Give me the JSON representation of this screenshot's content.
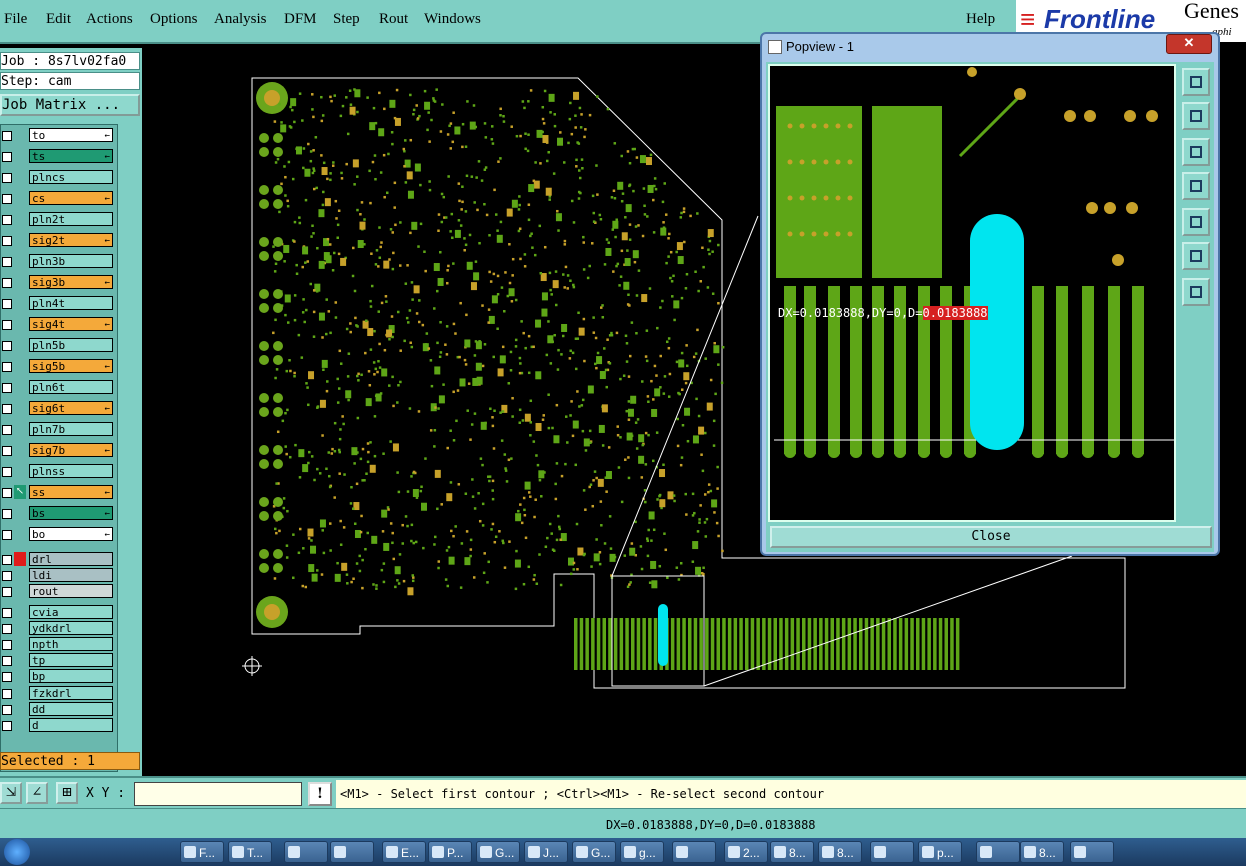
{
  "menu": {
    "items": [
      "File",
      "Edit",
      "Actions",
      "Options",
      "Analysis",
      "DFM",
      "Step",
      "Rout",
      "Windows"
    ],
    "help": "Help",
    "brand": "Frontline",
    "brand_suffix": "Genes",
    "brand_sub": "aphi"
  },
  "left": {
    "job": "Job : 8s7lv02fa0",
    "step": "Step: cam",
    "job_matrix": "Job Matrix ...",
    "selected": "Selected : 1",
    "layers": [
      {
        "name": "to",
        "color": "#ffffff",
        "flag": "←"
      },
      {
        "name": "ts",
        "color": "#1f9a73",
        "flag": "←"
      },
      {
        "name": "plncs",
        "color": "#8ed8cd",
        "flag": ""
      },
      {
        "name": "cs",
        "color": "#f4a93a",
        "flag": "←"
      },
      {
        "name": "pln2t",
        "color": "#8ed8cd",
        "flag": ""
      },
      {
        "name": "sig2t",
        "color": "#f4a93a",
        "flag": "←"
      },
      {
        "name": "pln3b",
        "color": "#8ed8cd",
        "flag": ""
      },
      {
        "name": "sig3b",
        "color": "#f4a93a",
        "flag": "←"
      },
      {
        "name": "pln4t",
        "color": "#8ed8cd",
        "flag": ""
      },
      {
        "name": "sig4t",
        "color": "#f4a93a",
        "flag": "←"
      },
      {
        "name": "pln5b",
        "color": "#8ed8cd",
        "flag": ""
      },
      {
        "name": "sig5b",
        "color": "#f4a93a",
        "flag": "←"
      },
      {
        "name": "pln6t",
        "color": "#8ed8cd",
        "flag": ""
      },
      {
        "name": "sig6t",
        "color": "#f4a93a",
        "flag": "←"
      },
      {
        "name": "pln7b",
        "color": "#8ed8cd",
        "flag": ""
      },
      {
        "name": "sig7b",
        "color": "#f4a93a",
        "flag": "←"
      },
      {
        "name": "plnss",
        "color": "#8ed8cd",
        "flag": ""
      },
      {
        "name": "ss",
        "color": "#f4a93a",
        "flag": "←"
      },
      {
        "name": "bs",
        "color": "#1f9a73",
        "flag": "←"
      },
      {
        "name": "bo",
        "color": "#ffffff",
        "flag": "←"
      },
      {
        "name": "drl",
        "color": "#a9c0c4",
        "flag": ""
      },
      {
        "name": "ldi",
        "color": "#a9c0c4",
        "flag": ""
      },
      {
        "name": "rout",
        "color": "#d0d8d8",
        "flag": ""
      },
      {
        "name": "cvia",
        "color": "#8ed8cd",
        "flag": ""
      },
      {
        "name": "ydkdrl",
        "color": "#8ed8cd",
        "flag": ""
      },
      {
        "name": "npth",
        "color": "#8ed8cd",
        "flag": ""
      },
      {
        "name": "tp",
        "color": "#8ed8cd",
        "flag": ""
      },
      {
        "name": "bp",
        "color": "#8ed8cd",
        "flag": ""
      },
      {
        "name": "fzkdrl",
        "color": "#8ed8cd",
        "flag": ""
      },
      {
        "name": "dd",
        "color": "#8ed8cd",
        "flag": ""
      },
      {
        "name": "d",
        "color": "#8ed8cd",
        "flag": ""
      }
    ]
  },
  "command": {
    "xy_label": "X Y :",
    "xy_value": "",
    "prompt": "<M1> - Select first contour ; <Ctrl><M1> - Re-select second contour"
  },
  "status": "DX=0.0183888,DY=0,D=0.0183888",
  "popview": {
    "title": "Popview - 1",
    "close_label": "Close",
    "measure_prefix": "DX=0.0183888,DY=0,D=",
    "measure_highlight": "0.0183888"
  },
  "taskbar": {
    "items": [
      "F...",
      "T...",
      "",
      "",
      "E...",
      "P...",
      "G...",
      "J...",
      "G...",
      "g...",
      "",
      "2...",
      "8...",
      "8...",
      "",
      "p...",
      "",
      "8...",
      ""
    ]
  },
  "colors": {
    "board": "#2f8f12",
    "copper": "#5ea617",
    "pad": "#c7a12a",
    "highlight": "#00e5ef"
  }
}
